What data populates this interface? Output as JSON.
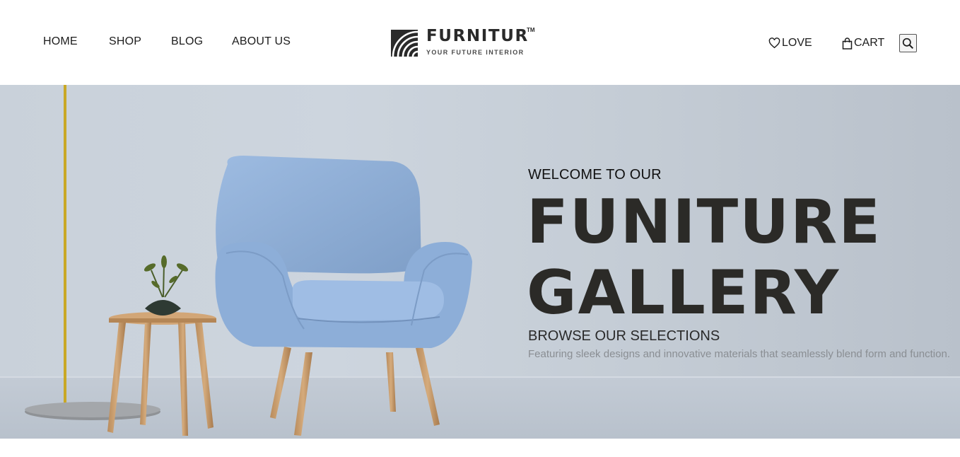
{
  "nav": {
    "items": [
      {
        "label": "HOME"
      },
      {
        "label": "SHOP"
      },
      {
        "label": "BLOG"
      },
      {
        "label": "ABOUT US"
      }
    ]
  },
  "logo": {
    "name": "FURNITUR",
    "trademark": "TM",
    "tagline": "YOUR FUTURE INTERIOR"
  },
  "actions": {
    "love_label": "LOVE",
    "cart_label": "CART",
    "icons": [
      "heart-icon",
      "bag-icon",
      "search-icon"
    ]
  },
  "hero": {
    "kicker": "WELCOME TO OUR",
    "title_line1": "FUNITURE",
    "title_line2": "GALLERY",
    "subtitle": "BROWSE OUR SELECTIONS",
    "description": "Featuring sleek designs and innovative materials that seamlessly blend form and function."
  },
  "colors": {
    "hero_background": "#c9d1da",
    "chair": "#8fb0d8",
    "wood": "#c49a6c",
    "title_text": "#2b2a27",
    "description_text": "#8a8e93"
  }
}
